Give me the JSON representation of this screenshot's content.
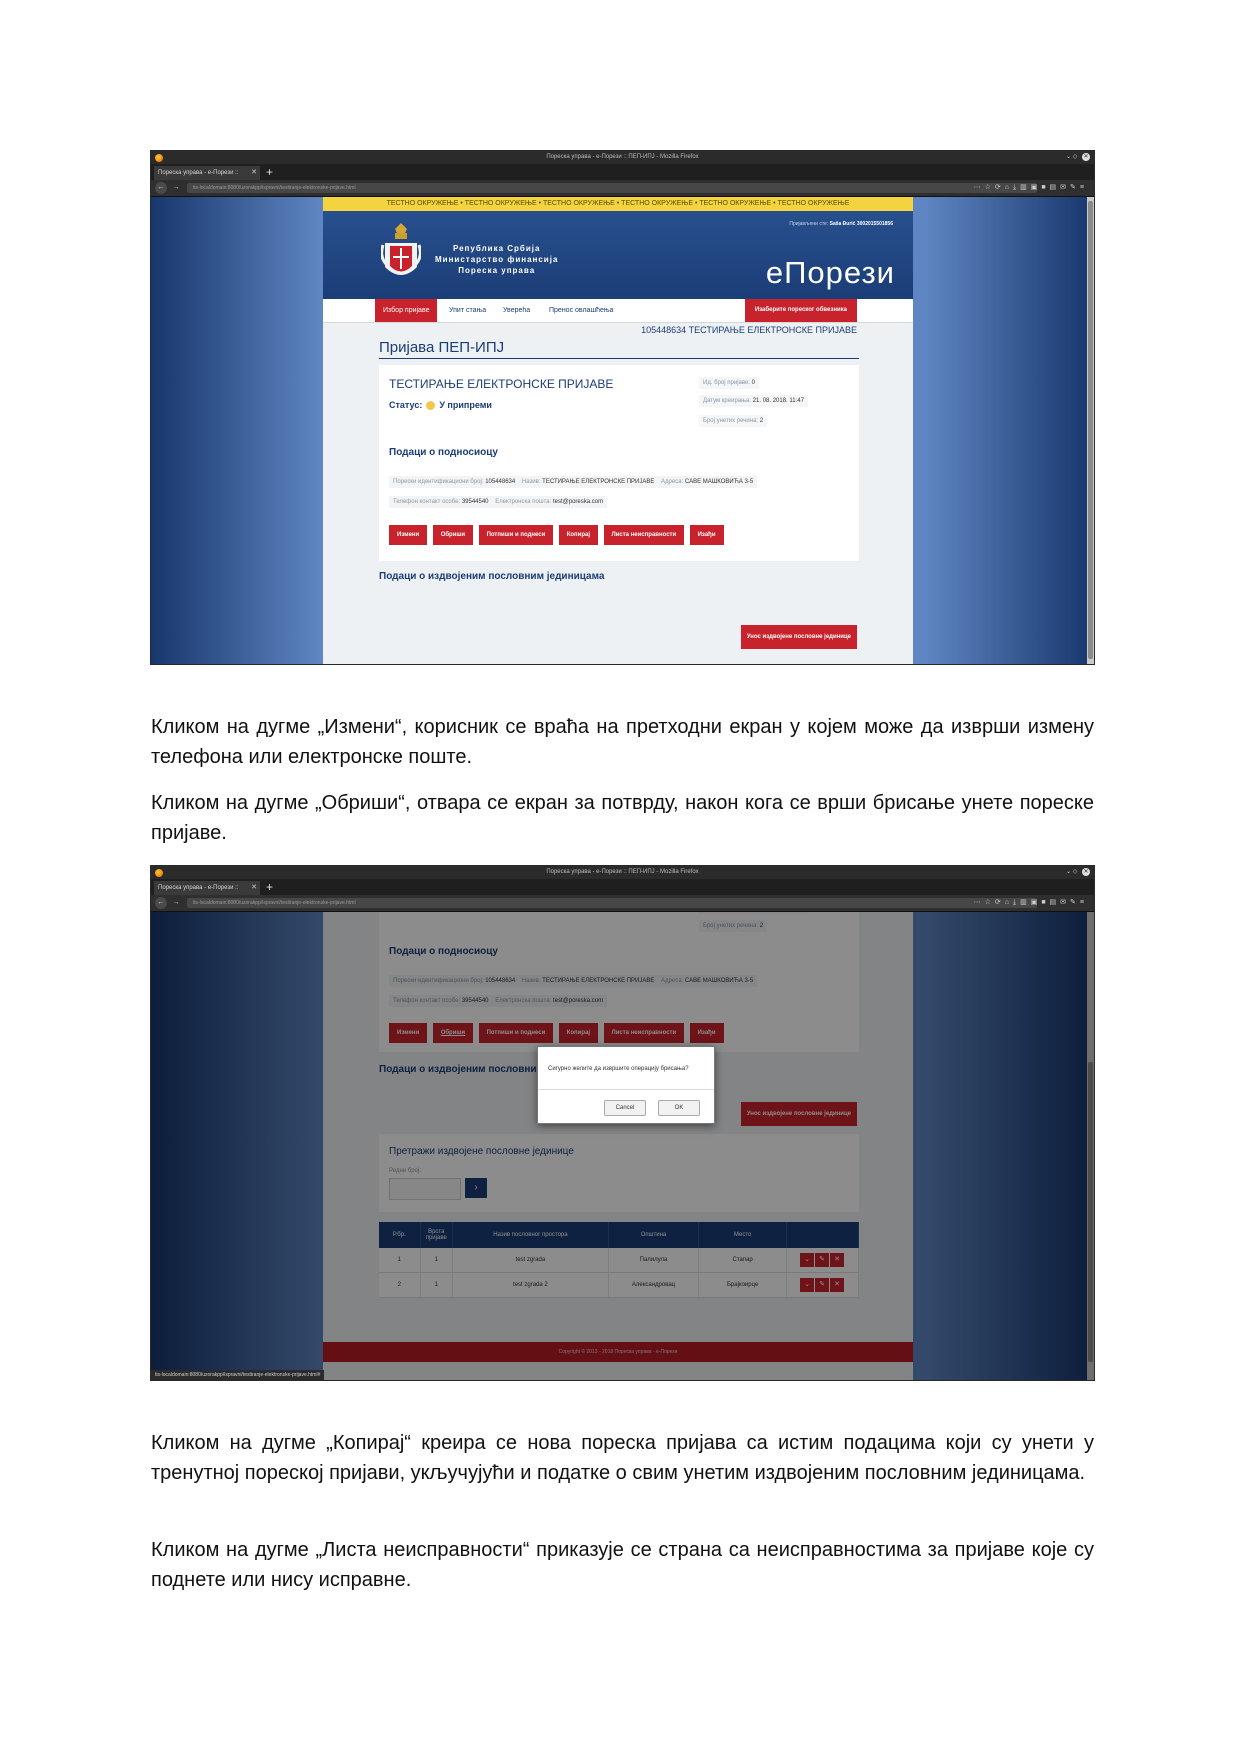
{
  "browser": {
    "window_title": "Пореска управа - е-Порези :: ПЕП-ИПЈ - Mozilla Firefox",
    "tab_title": "Пореска управа - е-Порези ::",
    "url": "tis-localdomain:8080/uzorakpp/ispravni/testiranje-elektronske-prijave.html"
  },
  "site": {
    "test_banner": "ТЕСТНО ОКРУЖЕЊЕ • ТЕСТНО ОКРУЖЕЊЕ • ТЕСТНО ОКРУЖЕЊЕ • ТЕСТНО ОКРУЖЕЊЕ • ТЕСТНО ОКРУЖЕЊЕ • ТЕСТНО ОКРУЖЕЊЕ",
    "ministry_line1": "Република Србија",
    "ministry_line2": "Министарство финансија",
    "ministry_line3": "Пореска управа",
    "brand": "еПорези",
    "login_label": "Пријављени сте:",
    "login_user": "Saša Đurić 3002015501856",
    "menu": [
      "Избор пријаве",
      "Упит стања",
      "Увереhа",
      "Пренос овлашћења"
    ],
    "menu_right": "Изаберите пореског обвезника",
    "taxpayer": "105448634 ТЕСТИРАЊЕ ЕЛЕКТРОНСКЕ ПРИЈАВЕ",
    "page_title": "Пријава ПЕП-ИПЈ",
    "card_title": "ТЕСТИРАЊЕ ЕЛЕКТРОНСКЕ ПРИЈАВЕ",
    "status_label": "Статус:",
    "status_value": "У припреми",
    "meta_id_label": "Ид. број пријаве:",
    "meta_id_value": "0",
    "meta_date_label": "Датум креирања:",
    "meta_date_value": "21. 08. 2018. 11:47",
    "meta_count_label": "Број унетих речина:",
    "meta_count_value": "2",
    "section_submitter": "Подаци о подносиоцу",
    "pib_label": "Порески идентификациони број:",
    "pib_value": "105448634",
    "name_label": "Назив:",
    "name_value": "ТЕСТИРАЊЕ ЕЛЕКТРОНСКЕ ПРИЈАВЕ",
    "address_label": "Адреса:",
    "address_value": "САВЕ МАШКОВИЋА 3-5",
    "phone_label": "Телефон контакт особе:",
    "phone_value": "39544540",
    "email_label": "Електронска пошта:",
    "email_value": "test@poreska.com",
    "buttons": [
      "Измени",
      "Обриши",
      "Потпиши и поднеси",
      "Копирај",
      "Листа неисправности",
      "Изађи"
    ],
    "section_units": "Подаци о издвојеним пословним јединицама",
    "add_unit": "Унос издвојене пословне јединице",
    "search_title": "Претражи издвојене пословне јединице",
    "search_label": "Редни број:",
    "table_headers": [
      "Р.бр.",
      "Врста пријаве",
      "Назив пословног простора",
      "Општина",
      "Место",
      ""
    ],
    "table_rows": [
      [
        "1",
        "1",
        "test zgrada",
        "Палилула",
        "Стапар",
        ""
      ],
      [
        "2",
        "1",
        "test zgrada 2",
        "Александровац",
        "Брајкоирце",
        ""
      ]
    ],
    "footer": "Copyright © 2013 - 2018 Пореска управа - е-Порези",
    "dialog_message": "Сигурно желите да извршите операцију брисања?",
    "dialog_cancel": "Cancel",
    "dialog_ok": "OK",
    "status_url": "tis-localdomain:8080/uzorakpp/ispravni/testiranje-elektronske-prijave.html#"
  },
  "text": {
    "p1": "Кликом на дугме „Измени“, корисник се враћа на претходни екран у којем може да изврши измену телефона или електронске поште.",
    "p2": "Кликом на дугме „Обриши“, отвара се екран за потврду, након кога се  врши  брисање унете пореске пријаве.",
    "p3": "Кликом на дугме „Копирај“ креира се нова пореска пријава са истим подацима који су унети у тренутној пореској пријави, укључујући и податке о свим унетим издвојеним пословним јединицама.",
    "p4": "Кликом на дугме „Листа неисправности“ приказује се страна са неисправностима за пријаве које су поднете или нису исправне."
  }
}
